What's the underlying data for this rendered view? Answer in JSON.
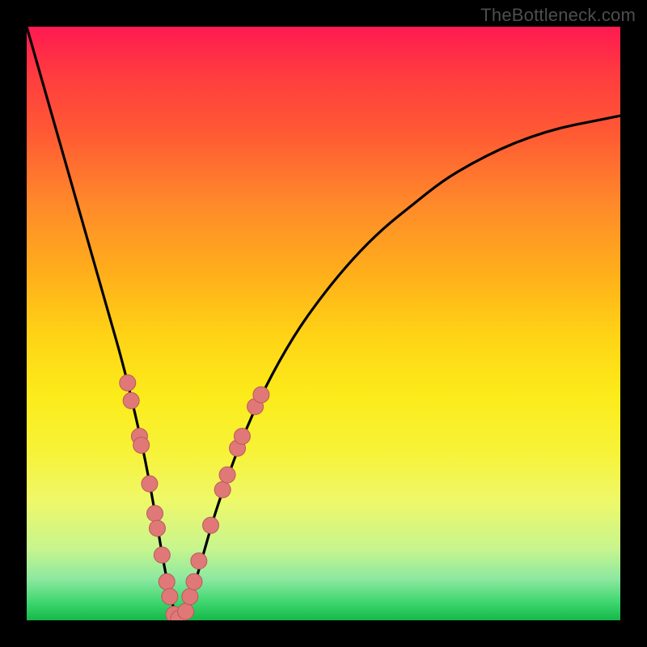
{
  "attribution": "TheBottleneck.com",
  "chart_data": {
    "type": "line",
    "title": "",
    "xlabel": "",
    "ylabel": "",
    "xlim": [
      0,
      100
    ],
    "ylim": [
      0,
      100
    ],
    "series": [
      {
        "name": "bottleneck-curve",
        "x": [
          0,
          2,
          4,
          6,
          8,
          10,
          12,
          14,
          16,
          18,
          20,
          22,
          23,
          24,
          25,
          26,
          27,
          28,
          30,
          32,
          36,
          40,
          45,
          50,
          55,
          60,
          65,
          70,
          75,
          80,
          85,
          90,
          95,
          100
        ],
        "y": [
          100,
          93,
          86,
          79,
          72,
          65,
          58,
          51,
          44,
          36,
          27,
          16,
          10,
          5,
          1,
          0,
          1,
          5,
          12,
          19,
          30,
          39,
          48,
          55,
          61,
          66,
          70,
          74,
          77,
          79.5,
          81.5,
          83,
          84,
          85
        ]
      }
    ],
    "markers": [
      {
        "x": 17.0,
        "y": 40.0
      },
      {
        "x": 17.6,
        "y": 37.0
      },
      {
        "x": 19.0,
        "y": 31.0
      },
      {
        "x": 19.3,
        "y": 29.5
      },
      {
        "x": 20.7,
        "y": 23.0
      },
      {
        "x": 21.6,
        "y": 18.0
      },
      {
        "x": 22.0,
        "y": 15.5
      },
      {
        "x": 22.8,
        "y": 11.0
      },
      {
        "x": 23.6,
        "y": 6.5
      },
      {
        "x": 24.1,
        "y": 4.0
      },
      {
        "x": 24.8,
        "y": 1.0
      },
      {
        "x": 25.6,
        "y": 0.3
      },
      {
        "x": 26.8,
        "y": 1.5
      },
      {
        "x": 27.5,
        "y": 4.0
      },
      {
        "x": 28.2,
        "y": 6.5
      },
      {
        "x": 29.0,
        "y": 10.0
      },
      {
        "x": 31.0,
        "y": 16.0
      },
      {
        "x": 33.0,
        "y": 22.0
      },
      {
        "x": 33.8,
        "y": 24.5
      },
      {
        "x": 35.5,
        "y": 29.0
      },
      {
        "x": 36.3,
        "y": 31.0
      },
      {
        "x": 38.5,
        "y": 36.0
      },
      {
        "x": 39.5,
        "y": 38.0
      }
    ],
    "marker_style": {
      "fill": "#e07878",
      "stroke": "#b85a5a",
      "radius_px": 10
    }
  }
}
